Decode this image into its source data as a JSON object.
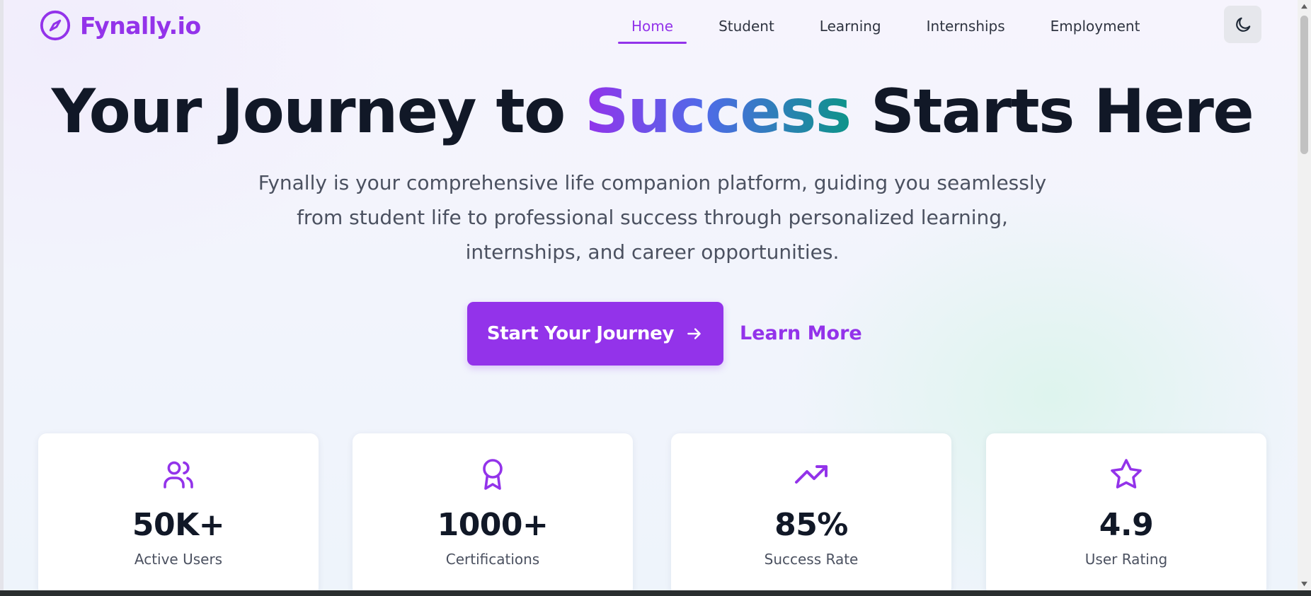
{
  "brand": {
    "name": "Fynally.io",
    "icon": "compass-icon",
    "color": "#9333ea"
  },
  "nav": {
    "items": [
      {
        "label": "Home",
        "active": true
      },
      {
        "label": "Student",
        "active": false
      },
      {
        "label": "Learning",
        "active": false
      },
      {
        "label": "Internships",
        "active": false
      },
      {
        "label": "Employment",
        "active": false
      }
    ],
    "theme_toggle_icon": "moon-icon"
  },
  "hero": {
    "title_before": "Your Journey to ",
    "title_highlight": "Success",
    "title_after": " Starts Here",
    "subtitle": "Fynally is your comprehensive life companion platform, guiding you seamlessly from student life to professional success through personalized learning, internships, and career opportunities.",
    "primary_cta": "Start Your Journey",
    "primary_cta_icon": "arrow-right-icon",
    "secondary_cta": "Learn More"
  },
  "stats": [
    {
      "icon": "users-icon",
      "value": "50K+",
      "label": "Active Users"
    },
    {
      "icon": "award-icon",
      "value": "1000+",
      "label": "Certifications"
    },
    {
      "icon": "trending-up-icon",
      "value": "85%",
      "label": "Success Rate"
    },
    {
      "icon": "star-icon",
      "value": "4.9",
      "label": "User Rating"
    }
  ],
  "colors": {
    "accent": "#9333ea",
    "heading": "#111827",
    "gradient": [
      "#9333ea",
      "#4f6be8",
      "#0d9488"
    ]
  }
}
